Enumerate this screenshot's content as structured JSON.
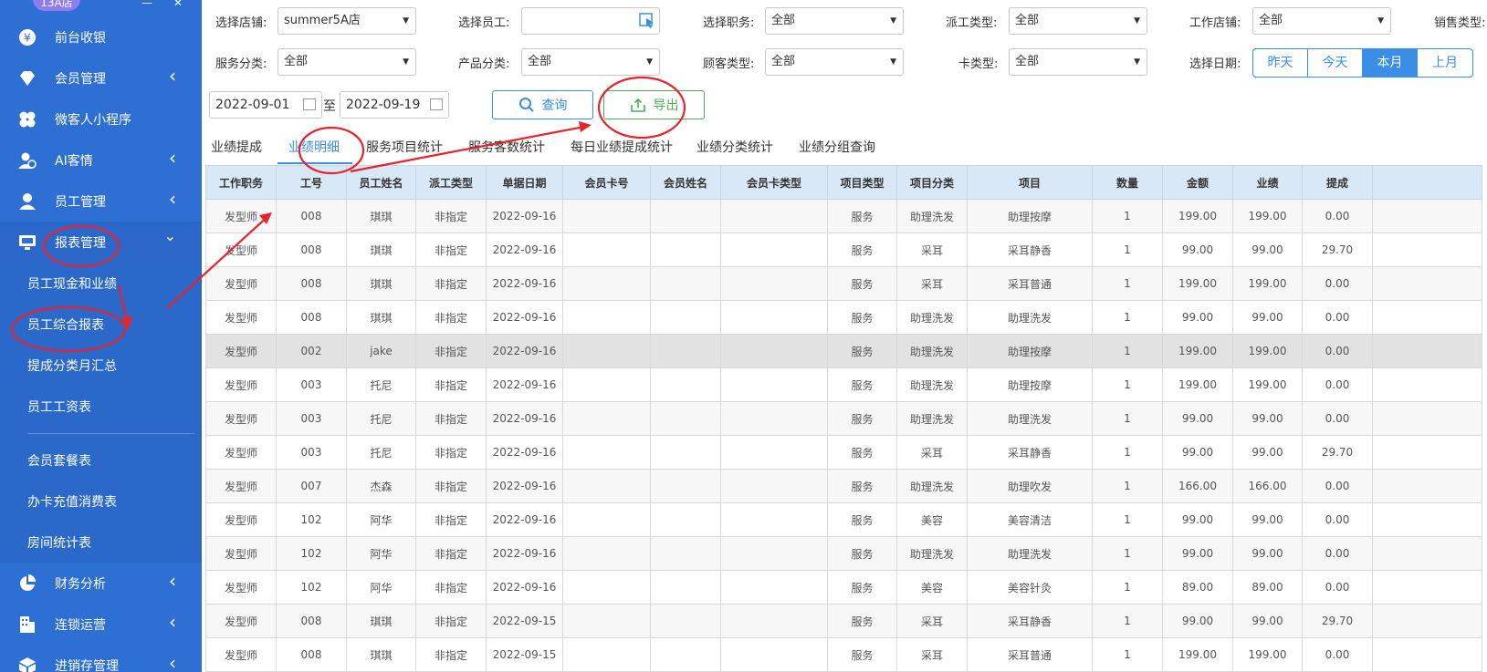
{
  "sidebar": {
    "store_badge": "13A店",
    "items": [
      {
        "label": "前台收银",
        "icon": "yen-icon",
        "chev": ""
      },
      {
        "label": "会员管理",
        "icon": "diamond-icon",
        "chev": "<"
      },
      {
        "label": "微客人小程序",
        "icon": "clover-icon",
        "chev": ""
      },
      {
        "label": "AI客情",
        "icon": "ai-user-icon",
        "chev": "<"
      },
      {
        "label": "员工管理",
        "icon": "user-icon",
        "chev": "<"
      },
      {
        "label": "报表管理",
        "icon": "monitor-icon",
        "chev": "v"
      }
    ],
    "sub_items": [
      "员工现金和业绩",
      "员工综合报表",
      "提成分类月汇总",
      "员工工资表"
    ],
    "sub_items2": [
      "会员套餐表",
      "办卡充值消费表",
      "房间统计表"
    ],
    "items2": [
      {
        "label": "财务分析",
        "icon": "pie-icon",
        "chev": "<"
      },
      {
        "label": "连锁运营",
        "icon": "building-icon",
        "chev": "<"
      },
      {
        "label": "进销存管理",
        "icon": "box-icon",
        "chev": "<"
      }
    ]
  },
  "filters": {
    "store_label": "选择店铺:",
    "store_value": "summer5A店",
    "staff_label": "选择员工:",
    "staff_value": "",
    "role_label": "选择职务:",
    "role_value": "全部",
    "dispatch_label": "派工类型:",
    "dispatch_value": "全部",
    "work_store_label": "工作店铺:",
    "work_store_value": "全部",
    "sales_label": "销售类型:",
    "service_label": "服务分类:",
    "service_value": "全部",
    "product_label": "产品分类:",
    "product_value": "全部",
    "customer_label": "顾客类型:",
    "customer_value": "全部",
    "card_label": "卡类型:",
    "card_value": "全部",
    "date_label": "选择日期:",
    "date_buttons": [
      "昨天",
      "今天",
      "本月",
      "上月"
    ],
    "date_active": "本月",
    "date_from": "2022-09-01",
    "date_sep": "至",
    "date_to": "2022-09-19",
    "query_label": "查询",
    "export_label": "导出"
  },
  "tabs": [
    "业绩提成",
    "业绩明细",
    "服务项目统计",
    "服务客数统计",
    "每日业绩提成统计",
    "业绩分类统计",
    "业绩分组查询"
  ],
  "active_tab": "业绩明细",
  "table": {
    "headers": [
      "工作职务",
      "工号",
      "员工姓名",
      "派工类型",
      "单据日期",
      "会员卡号",
      "会员姓名",
      "会员卡类型",
      "项目类型",
      "项目分类",
      "项目",
      "数量",
      "金额",
      "业绩",
      "提成",
      ""
    ],
    "rows": [
      [
        "发型师",
        "008",
        "琪琪",
        "非指定",
        "2022-09-16",
        "",
        "",
        "",
        "服务",
        "助理洗发",
        "助理按摩",
        "1",
        "199.00",
        "199.00",
        "0.00"
      ],
      [
        "发型师",
        "008",
        "琪琪",
        "非指定",
        "2022-09-16",
        "",
        "",
        "",
        "服务",
        "采耳",
        "采耳静香",
        "1",
        "99.00",
        "99.00",
        "29.70"
      ],
      [
        "发型师",
        "008",
        "琪琪",
        "非指定",
        "2022-09-16",
        "",
        "",
        "",
        "服务",
        "采耳",
        "采耳普通",
        "1",
        "199.00",
        "199.00",
        "0.00"
      ],
      [
        "发型师",
        "008",
        "琪琪",
        "非指定",
        "2022-09-16",
        "",
        "",
        "",
        "服务",
        "助理洗发",
        "助理洗发",
        "1",
        "99.00",
        "99.00",
        "0.00"
      ],
      [
        "发型师",
        "002",
        "jake",
        "非指定",
        "2022-09-16",
        "",
        "",
        "",
        "服务",
        "助理洗发",
        "助理按摩",
        "1",
        "199.00",
        "199.00",
        "0.00"
      ],
      [
        "发型师",
        "003",
        "托尼",
        "非指定",
        "2022-09-16",
        "",
        "",
        "",
        "服务",
        "助理洗发",
        "助理按摩",
        "1",
        "199.00",
        "199.00",
        "0.00"
      ],
      [
        "发型师",
        "003",
        "托尼",
        "非指定",
        "2022-09-16",
        "",
        "",
        "",
        "服务",
        "助理洗发",
        "助理洗发",
        "1",
        "99.00",
        "99.00",
        "0.00"
      ],
      [
        "发型师",
        "003",
        "托尼",
        "非指定",
        "2022-09-16",
        "",
        "",
        "",
        "服务",
        "采耳",
        "采耳静香",
        "1",
        "99.00",
        "99.00",
        "29.70"
      ],
      [
        "发型师",
        "007",
        "杰森",
        "非指定",
        "2022-09-16",
        "",
        "",
        "",
        "服务",
        "助理洗发",
        "助理吹发",
        "1",
        "166.00",
        "166.00",
        "0.00"
      ],
      [
        "发型师",
        "102",
        "阿华",
        "非指定",
        "2022-09-16",
        "",
        "",
        "",
        "服务",
        "美容",
        "美容清洁",
        "1",
        "99.00",
        "99.00",
        "0.00"
      ],
      [
        "发型师",
        "102",
        "阿华",
        "非指定",
        "2022-09-16",
        "",
        "",
        "",
        "服务",
        "助理洗发",
        "助理洗发",
        "1",
        "99.00",
        "99.00",
        "0.00"
      ],
      [
        "发型师",
        "102",
        "阿华",
        "非指定",
        "2022-09-16",
        "",
        "",
        "",
        "服务",
        "美容",
        "美容针灸",
        "1",
        "89.00",
        "89.00",
        "0.00"
      ],
      [
        "发型师",
        "008",
        "琪琪",
        "非指定",
        "2022-09-15",
        "",
        "",
        "",
        "服务",
        "采耳",
        "采耳静香",
        "1",
        "99.00",
        "99.00",
        "29.70"
      ],
      [
        "发型师",
        "008",
        "琪琪",
        "非指定",
        "2022-09-15",
        "",
        "",
        "",
        "服务",
        "采耳",
        "采耳普通",
        "1",
        "199.00",
        "199.00",
        "0.00"
      ]
    ],
    "highlight_row": 4
  },
  "colors": {
    "sidebar": "#2d6fd3",
    "accent": "#3a8ee6",
    "export": "#4cb050",
    "annotation": "#e8232d"
  }
}
